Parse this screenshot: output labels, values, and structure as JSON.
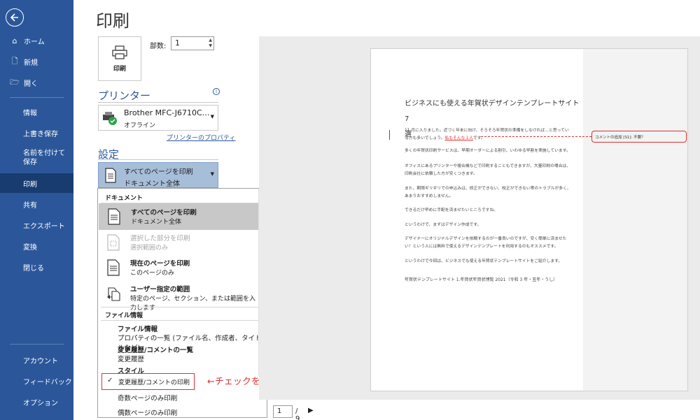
{
  "sidebar": {
    "items": [
      {
        "label": "ホーム"
      },
      {
        "label": "新規"
      },
      {
        "label": "開く"
      },
      {
        "label": "情報"
      },
      {
        "label": "上書き保存"
      },
      {
        "label": "名前を付けて保存"
      },
      {
        "label": "印刷"
      },
      {
        "label": "共有"
      },
      {
        "label": "エクスポート"
      },
      {
        "label": "変換"
      },
      {
        "label": "閉じる"
      }
    ],
    "bottom": [
      {
        "label": "アカウント"
      },
      {
        "label": "フィードバック"
      },
      {
        "label": "オプション"
      }
    ],
    "accent": "#2b579a",
    "active_bg": "#193c70"
  },
  "page_title": "印刷",
  "print_button_label": "印刷",
  "copies": {
    "label": "部数:",
    "value": "1"
  },
  "printer": {
    "heading": "プリンター",
    "name": "Brother MFC-J6710C…",
    "status": "オフライン",
    "properties_link": "プリンターのプロパティ"
  },
  "settings": {
    "heading": "設定",
    "selected_line1": "すべてのページを印刷",
    "selected_line2": "ドキュメント全体"
  },
  "dropdown": {
    "header_document": "ドキュメント",
    "items": [
      {
        "title": "すべてのページを印刷",
        "sub": "ドキュメント全体"
      },
      {
        "title": "選択した部分を印刷",
        "sub": "選択範囲のみ"
      },
      {
        "title": "現在のページを印刷",
        "sub": "このページのみ"
      },
      {
        "title": "ユーザー指定の範囲",
        "sub": "特定のページ、セクション、または範囲を入力します"
      }
    ],
    "header_fileinfo": "ファイル情報",
    "fileinfo_title": "ファイル情報",
    "fileinfo_sub": "プロパティの一覧 (ファイル名、作成者、タイトルなど)",
    "changes_title": "変更履歴/コメントの一覧",
    "changes_sub": "変更履歴",
    "styles_title": "スタイル",
    "track_changes_label": "変更履歴/コメントの印刷",
    "odd_label": "奇数ページのみ印刷",
    "even_label": "偶数ページのみ印刷"
  },
  "annotation": "←チェックを外す",
  "preview": {
    "title_line1": "ビジネスにも使える年賀状デザインテンプレートサイト　7",
    "title_line2": "選",
    "p1a": "11 月に入りました。近づく年末に向け、そろそろ年賀状の準備をしなければ…と思ってい",
    "p1b": "る方も多いでしょう。",
    "p1_red": "私もそんな１人",
    "p1_tail": "です。",
    "p2": "多くの年賀状印刷サービスは、早期オーダーによる割引、いわゆる早割を実施しています。",
    "p3a": "オフィスにあるプリンターや複合機などで印刷することもできますが、大量印刷の場合は、",
    "p3b": "印刷会社に依頼した方が安くつきます。",
    "p4a": "また、期限ギリギリでの申込みは、修正ができない、校正ができない等のトラブルが多く、",
    "p4b": "あまりおすすめしません。",
    "p5": "できるだけ早めに手配を済ませたいところですね。",
    "p6": "というわけで、まずはデザイン作成です。",
    "p7a": "デザイナーにオリジナルデザインを依頼するのが一番良いのですが、安く簡単に済ませた",
    "p7b": "い！という人には無料で使えるデザインテンプレートを利用するのもオススメです。",
    "p8": "というわけで今回は、ビジネスでも使える年賀状テンプレートサイトをご紹介します。",
    "p9": "年賀状テンプレートサイト 1.年賀状年賀状博覧 2021（令和 3 年・丑年・うし）",
    "comment": "コメントの追加 [S1]: 不要？"
  },
  "pager": {
    "current": "1",
    "total": "/ 9"
  }
}
